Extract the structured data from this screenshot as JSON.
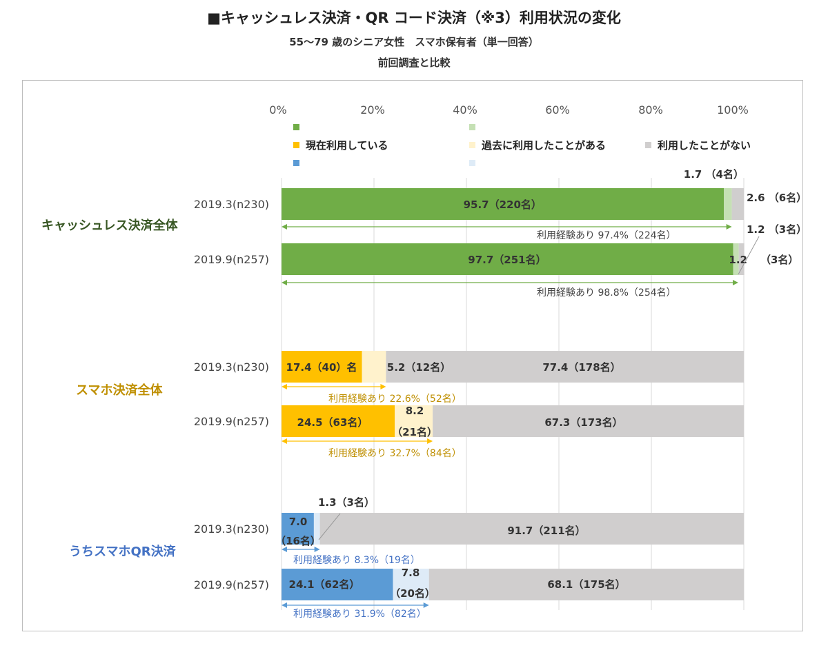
{
  "titles": {
    "main": "■キャッシュレス決済・QR コード決済（※3）利用状況の変化",
    "sub": "55～79 歳のシニア女性　スマホ保有者（単一回答）",
    "note": "前回調査と比較"
  },
  "chart_data": {
    "type": "bar",
    "orientation": "horizontal",
    "stacked": true,
    "xlim": [
      0,
      100
    ],
    "xticks": [
      "0%",
      "20%",
      "40%",
      "60%",
      "80%",
      "100%"
    ],
    "grid": true,
    "legend": {
      "placement": "top",
      "entries": [
        "現在利用している",
        "過去に利用したことがある",
        "利用したことがない"
      ]
    },
    "groups": [
      {
        "name": "キャッシュレス決済全体",
        "color_current": "#70ad47",
        "color_past": "#c5e0b4",
        "label_color": "#375623",
        "bars": [
          {
            "category": "2019.3(n230)",
            "values": [
              95.7,
              1.7,
              2.6
            ],
            "labels": [
              "95.7（220名）",
              "1.7 （4名）",
              "2.6 （6名）"
            ],
            "experience": "利用経験あり 97.4%（224名）",
            "experience_pct": 97.4
          },
          {
            "category": "2019.9(n257)",
            "values": [
              97.7,
              1.2,
              1.2
            ],
            "labels": [
              "97.7（251名）",
              "1.2 （3名）",
              "1.2",
              "（3名）"
            ],
            "experience": "利用経験あり 98.8%（254名）",
            "experience_pct": 98.8
          }
        ]
      },
      {
        "name": "スマホ決済全体",
        "color_current": "#ffc000",
        "color_past": "#fff2cc",
        "label_color": "#bf8f00",
        "bars": [
          {
            "category": "2019.3(n230)",
            "values": [
              17.4,
              5.2,
              77.4
            ],
            "labels": [
              "17.4（40）名",
              "5.2（12名）",
              "77.4（178名）"
            ],
            "experience": "利用経験あり 22.6%（52名）",
            "experience_pct": 22.6
          },
          {
            "category": "2019.9(n257)",
            "values": [
              24.5,
              8.2,
              67.3
            ],
            "labels": [
              "24.5（63名）",
              "8.2",
              "（21名）",
              "67.3（173名）"
            ],
            "experience": "利用経験あり 32.7%（84名）",
            "experience_pct": 32.7
          }
        ]
      },
      {
        "name": "うちスマホQR決済",
        "color_current": "#5b9bd5",
        "color_past": "#deebf7",
        "label_color": "#4472c4",
        "bars": [
          {
            "category": "2019.3(n230)",
            "values": [
              7.0,
              1.3,
              91.7
            ],
            "labels": [
              "7.0",
              "（16名）",
              "1.3（3名）",
              "91.7（211名）"
            ],
            "experience": "利用経験あり 8.3%（19名）",
            "experience_pct": 8.3
          },
          {
            "category": "2019.9(n257)",
            "values": [
              24.1,
              7.8,
              68.1
            ],
            "labels": [
              "24.1（62名）",
              "7.8",
              "（20名）",
              "68.1（175名）"
            ],
            "experience": "利用経験あり 31.9%（82名）",
            "experience_pct": 31.9
          }
        ]
      }
    ],
    "never_color": "#d0cece"
  }
}
